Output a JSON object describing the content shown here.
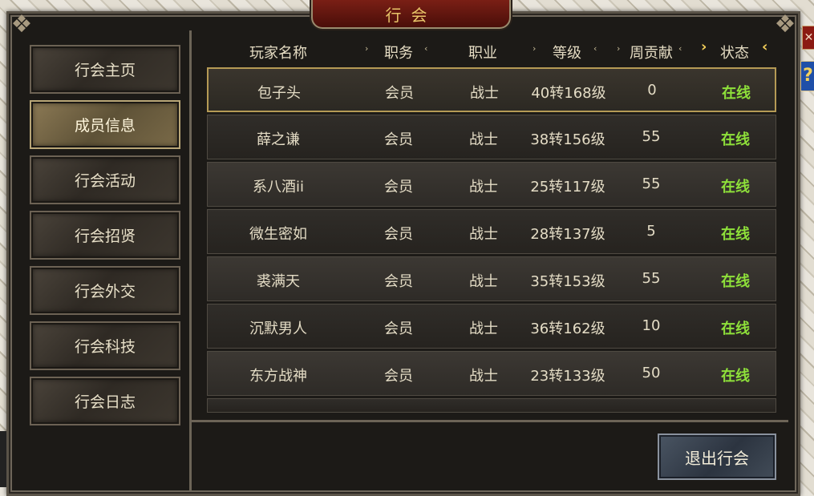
{
  "window": {
    "title": "行会"
  },
  "menu": {
    "items": [
      {
        "label": "行会主页"
      },
      {
        "label": "成员信息",
        "active": true
      },
      {
        "label": "行会活动"
      },
      {
        "label": "行会招贤"
      },
      {
        "label": "行会外交"
      },
      {
        "label": "行会科技"
      },
      {
        "label": "行会日志"
      }
    ]
  },
  "table": {
    "columns": {
      "name": "玩家名称",
      "position": "职务",
      "profession": "职业",
      "level": "等级",
      "weekly": "周贡献",
      "status": "状态"
    },
    "sort_left": "›",
    "sort_right": "‹",
    "rows": [
      {
        "name": "包子头",
        "position": "会员",
        "profession": "战士",
        "level": "40转168级",
        "weekly": "0",
        "status": "在线"
      },
      {
        "name": "薛之谦",
        "position": "会员",
        "profession": "战士",
        "level": "38转156级",
        "weekly": "55",
        "status": "在线"
      },
      {
        "name": "系八酒ii",
        "position": "会员",
        "profession": "战士",
        "level": "25转117级",
        "weekly": "55",
        "status": "在线"
      },
      {
        "name": "微生密如",
        "position": "会员",
        "profession": "战士",
        "level": "28转137级",
        "weekly": "5",
        "status": "在线"
      },
      {
        "name": "裘满天",
        "position": "会员",
        "profession": "战士",
        "level": "35转153级",
        "weekly": "55",
        "status": "在线"
      },
      {
        "name": "沉默男人",
        "position": "会员",
        "profession": "战士",
        "level": "36转162级",
        "weekly": "10",
        "status": "在线"
      },
      {
        "name": "东方战神",
        "position": "会员",
        "profession": "战士",
        "level": "23转133级",
        "weekly": "50",
        "status": "在线"
      }
    ]
  },
  "actions": {
    "exit_label": "退出行会"
  },
  "side_buttons": {
    "close": "✕",
    "help": "?"
  },
  "colors": {
    "online": "#8ee03a",
    "title": "#e9c66a"
  }
}
